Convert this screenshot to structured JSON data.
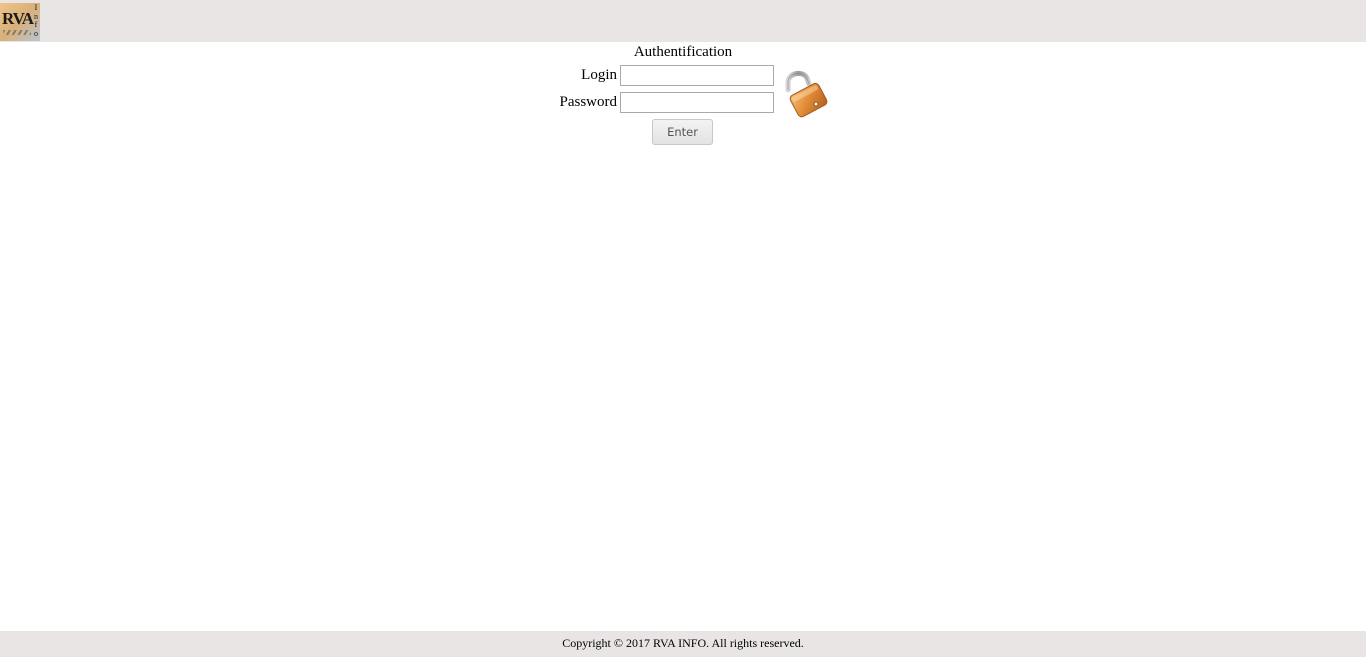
{
  "header": {
    "logo": {
      "main_text": "RVA",
      "side_text": "I\nn\nf\no",
      "icon": "rva-info-logo"
    }
  },
  "auth": {
    "title": "Authentification",
    "login_label": "Login",
    "login_value": "",
    "password_label": "Password",
    "password_value": "",
    "enter_label": "Enter",
    "lock_icon": "padlock-icon",
    "colors": {
      "lock_body": "#e08a36",
      "lock_shackle": "#a7a7a7"
    }
  },
  "footer": {
    "copyright": "Copyright © 2017 RVA INFO. All rights reserved."
  },
  "colors": {
    "bar_background": "#e8e5e4",
    "page_background": "#ffffff"
  }
}
